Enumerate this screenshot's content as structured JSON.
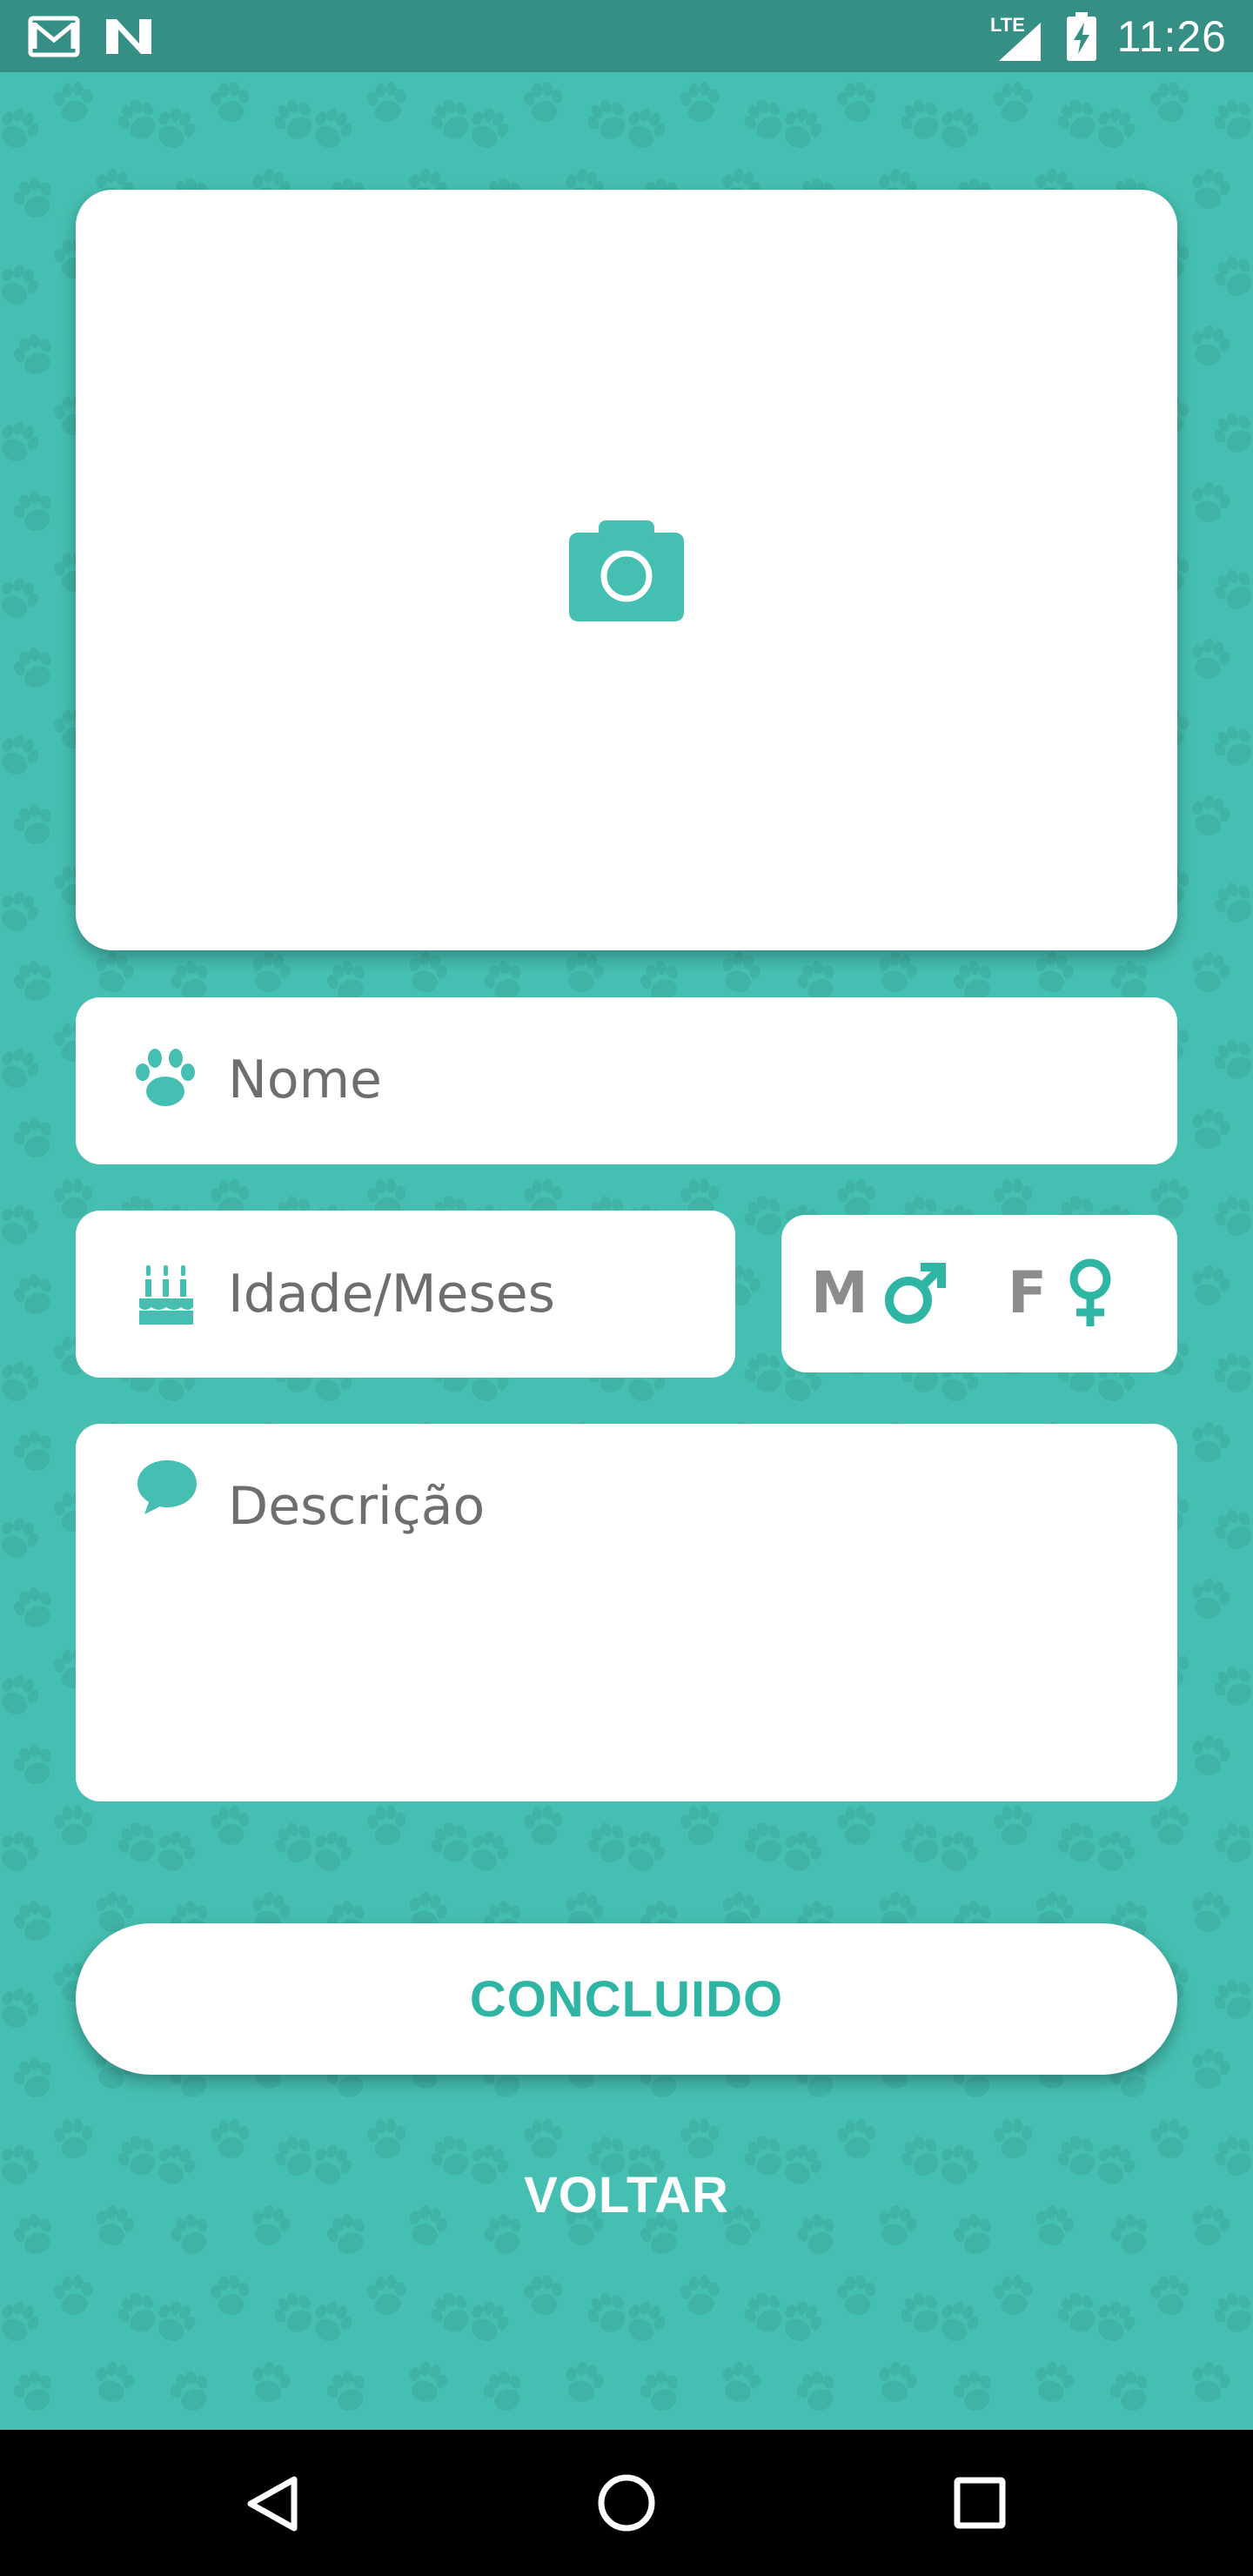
{
  "status_bar": {
    "time": "11:26",
    "network_label": "LTE",
    "left_icons": [
      "gmail-icon",
      "n-notification-icon"
    ],
    "right_icons": [
      "signal-icon",
      "battery-charging-icon"
    ]
  },
  "photo": {
    "icon": "camera-icon"
  },
  "form": {
    "name": {
      "icon": "paw-icon",
      "placeholder": "Nome"
    },
    "age": {
      "icon": "birthday-cake-icon",
      "placeholder": "Idade/Meses"
    },
    "sex": {
      "male_label": "M",
      "male_icon": "male-symbol-icon",
      "female_label": "F",
      "female_icon": "female-symbol-icon"
    },
    "description": {
      "icon": "speech-bubble-icon",
      "placeholder": "Descrição"
    }
  },
  "buttons": {
    "done_label": "CONCLUIDO",
    "back_label": "VOLTAR"
  },
  "nav_bar": {
    "icons": [
      "back-triangle-icon",
      "home-circle-icon",
      "recents-square-icon"
    ]
  },
  "colors": {
    "background": "#45bfb1",
    "status_bar": "#358f84",
    "accent": "#2fb5a4",
    "card": "#ffffff",
    "placeholder_text": "#6e6e6e",
    "sex_label": "#8c8c8c",
    "nav_bar": "#000000"
  }
}
